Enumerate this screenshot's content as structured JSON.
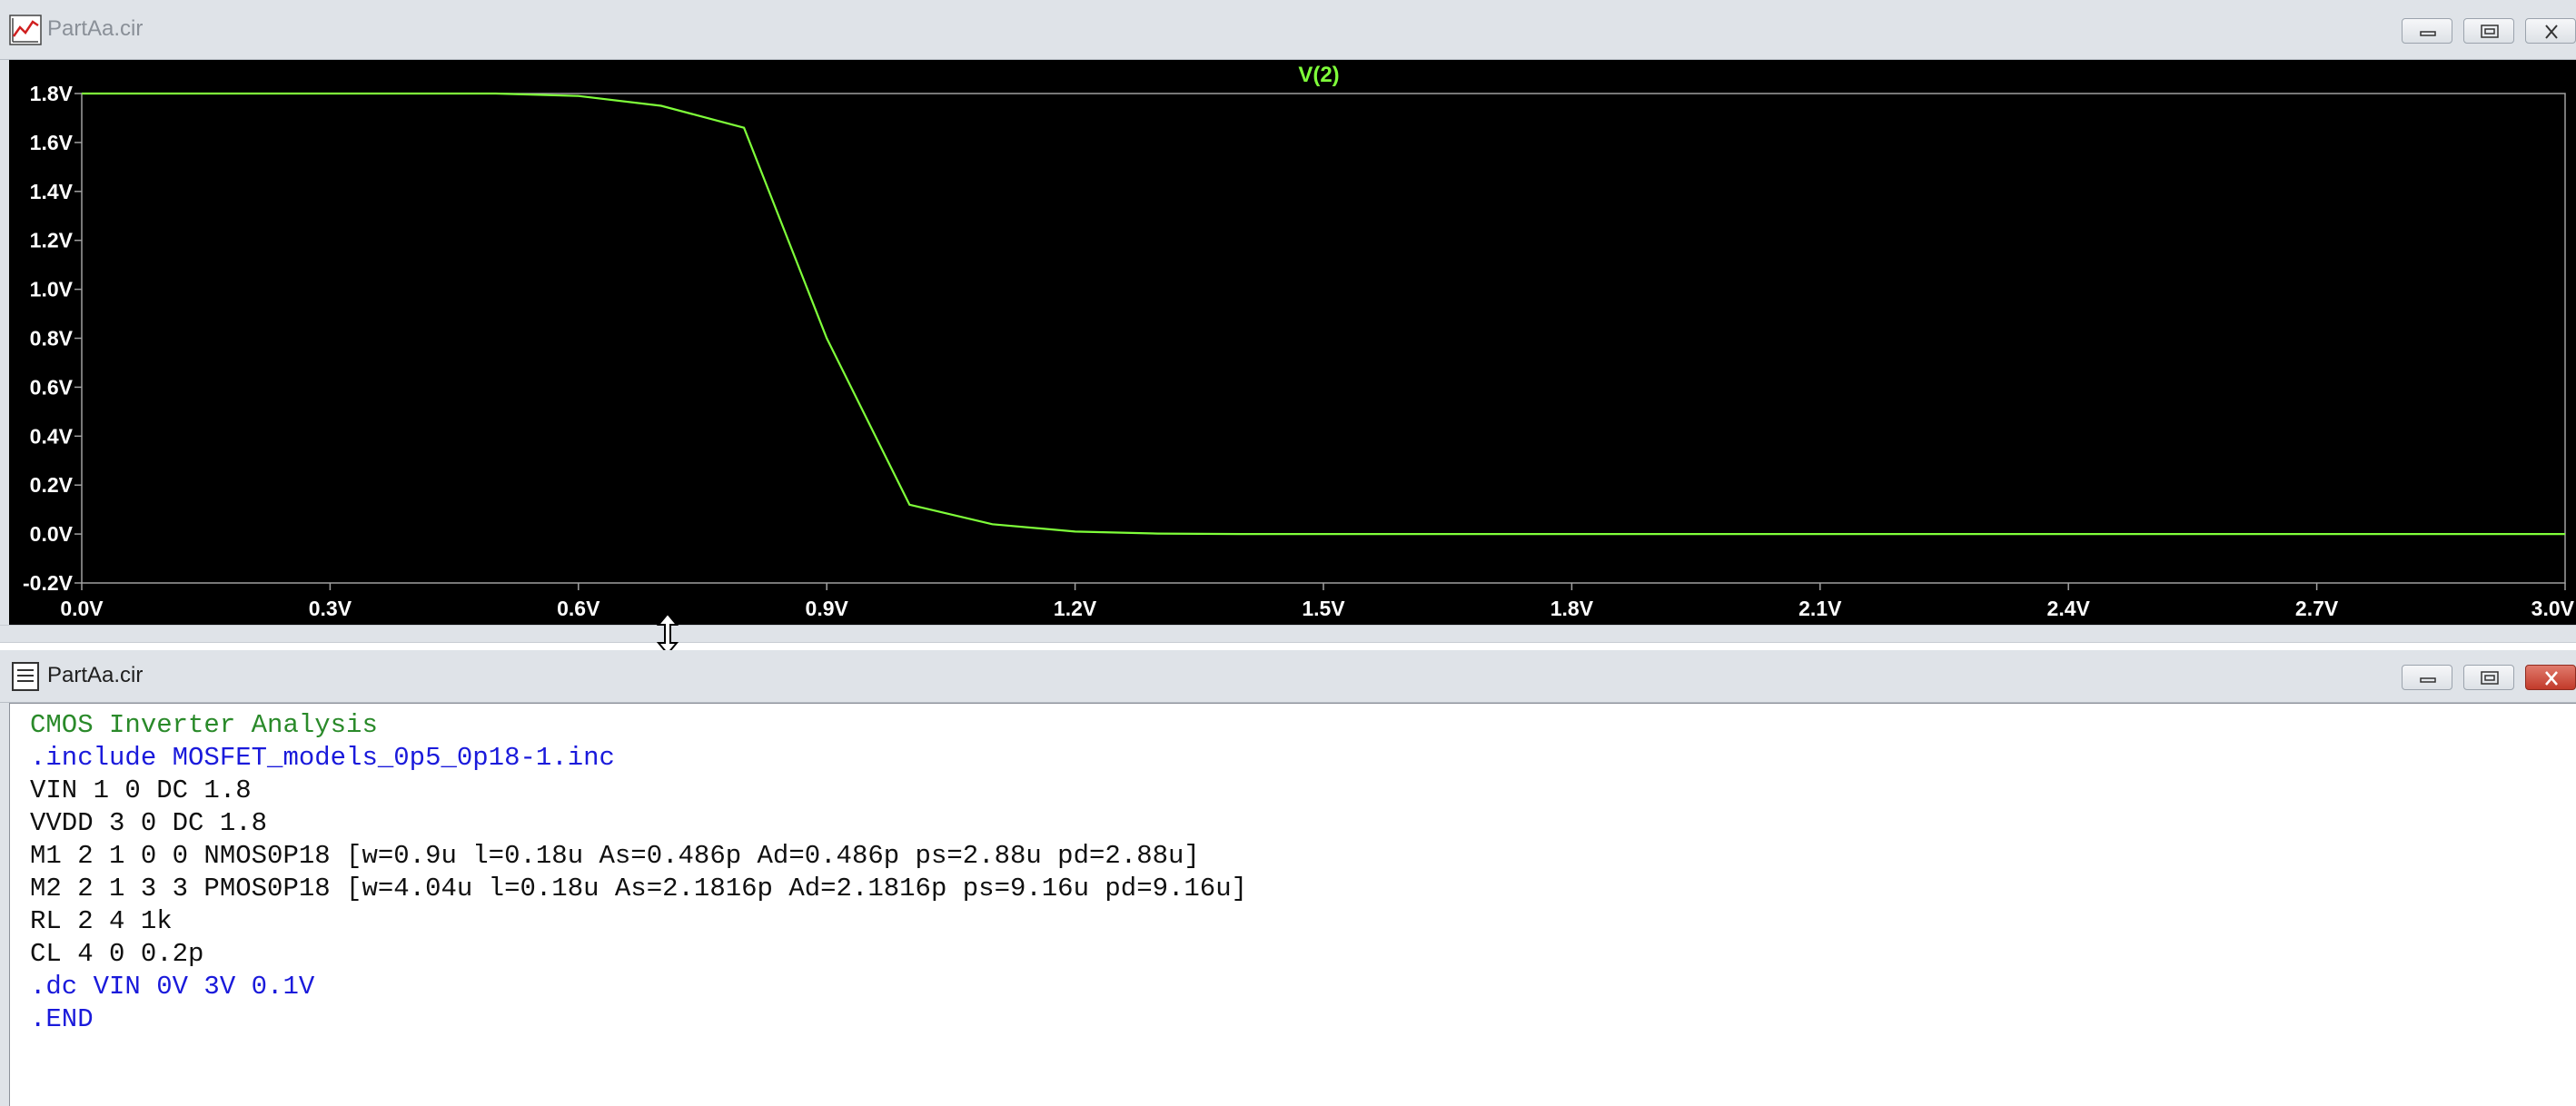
{
  "plot_window": {
    "title": "PartAa.cir",
    "trace_label": "V(2)",
    "trace_color": "#7fff3a",
    "icon": "waveform-icon",
    "buttons": [
      "minimize-icon",
      "restore-icon",
      "close-icon"
    ]
  },
  "chart_data": {
    "type": "line",
    "title": "V(2)",
    "xlabel": "",
    "ylabel": "",
    "xlim": [
      0,
      3.0
    ],
    "ylim": [
      -0.2,
      1.8
    ],
    "x_ticks": [
      "0.0V",
      "0.3V",
      "0.6V",
      "0.9V",
      "1.2V",
      "1.5V",
      "1.8V",
      "2.1V",
      "2.4V",
      "2.7V",
      "3.0V"
    ],
    "x_tick_values": [
      0,
      0.3,
      0.6,
      0.9,
      1.2,
      1.5,
      1.8,
      2.1,
      2.4,
      2.7,
      3.0
    ],
    "y_ticks": [
      "1.8V",
      "1.6V",
      "1.4V",
      "1.2V",
      "1.0V",
      "0.8V",
      "0.6V",
      "0.4V",
      "0.2V",
      "0.0V",
      "-0.2V"
    ],
    "y_tick_values": [
      1.8,
      1.6,
      1.4,
      1.2,
      1.0,
      0.8,
      0.6,
      0.4,
      0.2,
      0.0,
      -0.2
    ],
    "grid": false,
    "series": [
      {
        "name": "V(2)",
        "color": "#7fff3a",
        "x": [
          0.0,
          0.1,
          0.2,
          0.3,
          0.4,
          0.5,
          0.6,
          0.7,
          0.8,
          0.9,
          1.0,
          1.1,
          1.2,
          1.3,
          1.4,
          1.5,
          1.6,
          1.7,
          1.8,
          1.9,
          2.0,
          2.1,
          2.2,
          2.3,
          2.4,
          2.5,
          2.6,
          2.7,
          2.8,
          2.9,
          3.0
        ],
        "y": [
          1.8,
          1.8,
          1.8,
          1.8,
          1.8,
          1.8,
          1.79,
          1.75,
          1.66,
          0.8,
          0.12,
          0.04,
          0.01,
          0.002,
          0.0,
          0.0,
          0.0,
          0.0,
          0.0,
          0.0,
          0.0,
          0.0,
          0.0,
          0.0,
          0.0,
          0.0,
          0.0,
          0.0,
          0.0,
          0.0,
          0.0
        ]
      }
    ]
  },
  "netlist_window": {
    "title": "PartAa.cir",
    "icon": "document-icon",
    "buttons": [
      "minimize-icon",
      "restore-icon",
      "close-icon"
    ],
    "lines": [
      {
        "text": "CMOS Inverter Analysis",
        "kind": "comment"
      },
      {
        "text": ".include MOSFET_models_0p5_0p18-1.inc",
        "kind": "directive"
      },
      {
        "text": "VIN 1 0 DC 1.8",
        "kind": "plain"
      },
      {
        "text": "VVDD 3 0 DC 1.8",
        "kind": "plain"
      },
      {
        "text": "M1 2 1 0 0 NMOS0P18 [w=0.9u l=0.18u As=0.486p Ad=0.486p ps=2.88u pd=2.88u]",
        "kind": "plain"
      },
      {
        "text": "M2 2 1 3 3 PMOS0P18 [w=4.04u l=0.18u As=2.1816p Ad=2.1816p ps=9.16u pd=9.16u]",
        "kind": "plain"
      },
      {
        "text": "RL 2 4 1k",
        "kind": "plain"
      },
      {
        "text": "CL 4 0 0.2p",
        "kind": "plain"
      },
      {
        "text": ".dc VIN 0V 3V 0.1V",
        "kind": "directive"
      },
      {
        "text": ".END",
        "kind": "directive"
      }
    ]
  }
}
